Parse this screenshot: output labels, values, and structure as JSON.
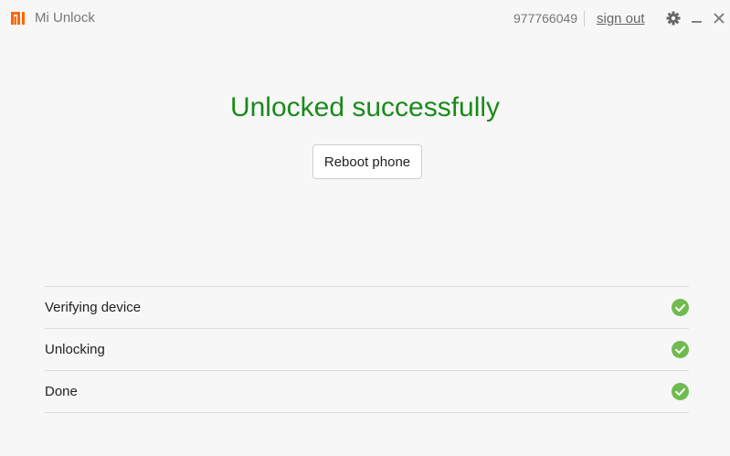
{
  "app": {
    "title": "Mi Unlock",
    "logo_icon": "mi-logo-icon",
    "brand_color": "#ff6700"
  },
  "header": {
    "user_id": "977766049",
    "signout_label": "sign out",
    "settings_icon": "gear-icon",
    "minimize_icon": "minimize-icon",
    "close_icon": "close-icon"
  },
  "main": {
    "status_title": "Unlocked successfully",
    "status_color": "#1a8a1a",
    "reboot_label": "Reboot phone"
  },
  "steps": [
    {
      "label": "Verifying device",
      "status": "done",
      "icon": "check-circle-icon"
    },
    {
      "label": "Unlocking",
      "status": "done",
      "icon": "check-circle-icon"
    },
    {
      "label": "Done",
      "status": "done",
      "icon": "check-circle-icon"
    }
  ],
  "colors": {
    "check_green": "#6fbb4f"
  }
}
